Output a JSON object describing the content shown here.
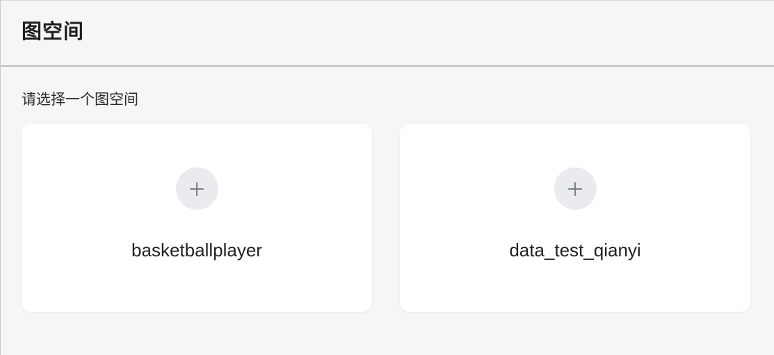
{
  "header": {
    "title": "图空间"
  },
  "main": {
    "subtitle": "请选择一个图空间",
    "spaces": [
      {
        "name": "basketballplayer",
        "icon": "plus-icon"
      },
      {
        "name": "data_test_qianyi",
        "icon": "plus-icon"
      }
    ]
  },
  "colors": {
    "background": "#f6f6f6",
    "card": "#ffffff",
    "icon_circle": "#e9ebef",
    "icon": "#7a7f88"
  }
}
